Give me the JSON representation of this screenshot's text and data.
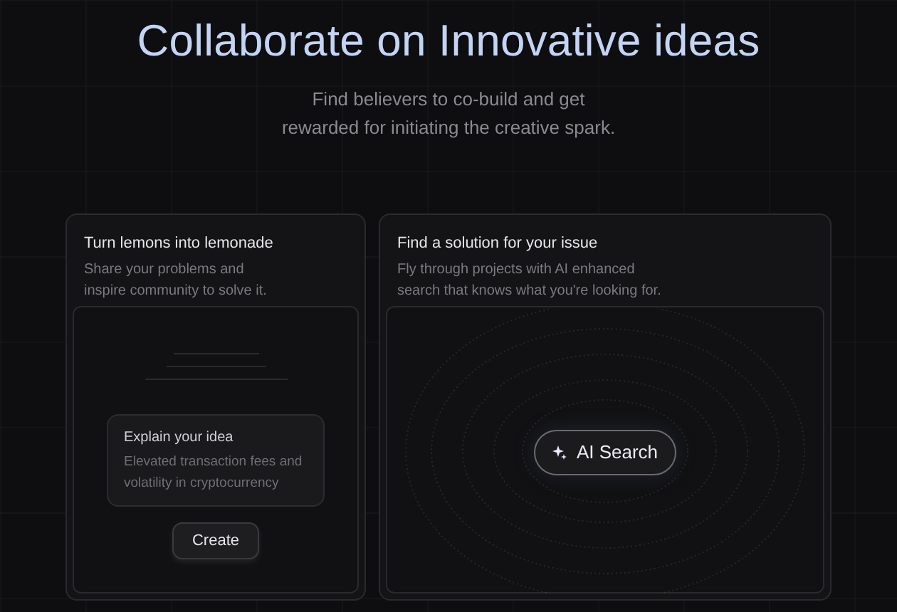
{
  "hero": {
    "title": "Collaborate on Innovative ideas",
    "subtitle_lines": [
      "Find believers to co-build and get",
      "rewarded for initiating the creative spark."
    ]
  },
  "cards": [
    {
      "kind": "idea",
      "title": "Turn lemons into lemonade",
      "description_lines": [
        "Share your problems and",
        "inspire community to solve it."
      ],
      "idea": {
        "title": "Explain your idea",
        "text_lines": [
          "Elevated transaction fees and",
          "volatility in cryptocurrency"
        ]
      },
      "button": "Create"
    },
    {
      "kind": "search",
      "title": "Find a solution for your issue",
      "description_lines": [
        "Fly through projects with AI enhanced",
        "search that knows what you're looking for."
      ],
      "button": "AI Search"
    }
  ]
}
